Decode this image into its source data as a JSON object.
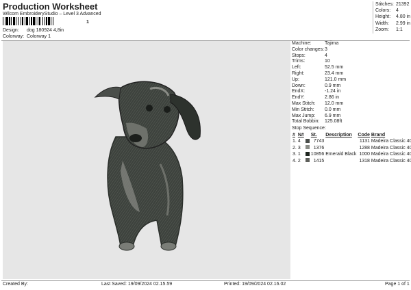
{
  "header": {
    "title": "Production Worksheet",
    "subtitle": "Wilcom EmbroideryStudio – Level 3 Advanced",
    "barcode_suffix": "1"
  },
  "meta": [
    {
      "label": "Design:",
      "value": "dog 180924 4,8in"
    },
    {
      "label": "Colorway:",
      "value": "Colorway 1"
    }
  ],
  "summary": [
    {
      "label": "Stitches:",
      "value": "21392"
    },
    {
      "label": "Colors:",
      "value": "4"
    },
    {
      "label": "Height:",
      "value": "4.80 in"
    },
    {
      "label": "Width:",
      "value": "2.99 in"
    },
    {
      "label": "Zoom:",
      "value": "1:1"
    }
  ],
  "details": [
    {
      "label": "Machine:",
      "value": "Tajima"
    },
    {
      "label": "Color changes:",
      "value": "3"
    },
    {
      "label": "Stops:",
      "value": "4"
    },
    {
      "label": "Trims:",
      "value": "10"
    },
    {
      "label": "Left:",
      "value": "52.5 mm"
    },
    {
      "label": "Right:",
      "value": "23.4 mm"
    },
    {
      "label": "Up:",
      "value": "121.0 mm"
    },
    {
      "label": "Down:",
      "value": "0.9 mm"
    },
    {
      "label": "EndX:",
      "value": "-1.24 in"
    },
    {
      "label": "EndY:",
      "value": "2.86 in"
    },
    {
      "label": "Max Stitch:",
      "value": "12.0 mm"
    },
    {
      "label": "Min Stitch:",
      "value": "0.0 mm"
    },
    {
      "label": "Max Jump:",
      "value": "6.9 mm"
    },
    {
      "label": "Total Bobbin:",
      "value": "125.08ft"
    }
  ],
  "stop_sequence": {
    "title": "Stop Sequence:",
    "headers": [
      "#",
      "N#",
      "St.",
      "Description",
      "Code",
      "Brand"
    ],
    "rows": [
      {
        "num": "1.",
        "n": "4",
        "color": "#4a4e4a",
        "st": "7743",
        "desc": "",
        "code": "1131",
        "brand": "Madeira Classic 40"
      },
      {
        "num": "2.",
        "n": "3",
        "color": "#8a8c86",
        "st": "1376",
        "desc": "",
        "code": "1288",
        "brand": "Madeira Classic 40"
      },
      {
        "num": "3.",
        "n": "1",
        "color": "#1f2620",
        "st": "10856",
        "desc": "Emerald Black",
        "code": "1000",
        "brand": "Madeira Classic 40"
      },
      {
        "num": "4.",
        "n": "2",
        "color": "#5e5f5b",
        "st": "1415",
        "desc": "",
        "code": "1318",
        "brand": "Madeira Classic 40"
      }
    ]
  },
  "footer": {
    "created": "Created By:",
    "saved": "Last Saved: 19/09/2024 02.15.59",
    "printed": "Printed: 19/09/2024 02.16.02",
    "page": "Page 1 of 1"
  }
}
